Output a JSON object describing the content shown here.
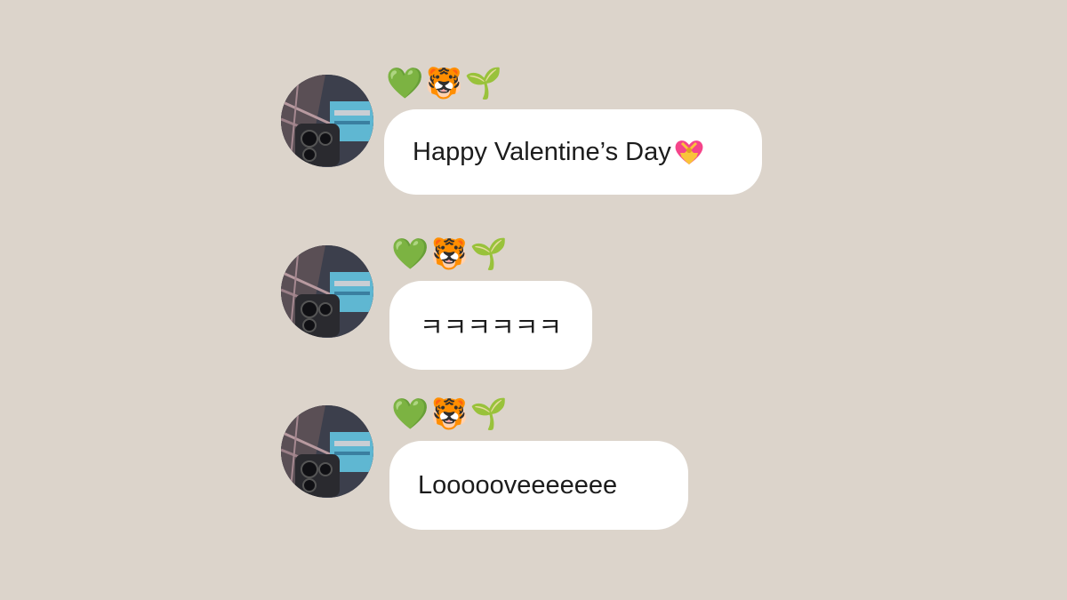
{
  "sender": {
    "display_name": {
      "heart": "💚",
      "tiger": "🐯",
      "sprout": "🌱"
    },
    "avatar_icon": "profile-photo-avatar"
  },
  "messages": [
    {
      "text": "Happy Valentine’s Day",
      "trailing_emoji": "💝"
    },
    {
      "text": "ㅋㅋㅋㅋㅋㅋ"
    },
    {
      "text": "Loooooveeeeeee"
    }
  ],
  "colors": {
    "background": "#dcd4cb",
    "bubble": "#ffffff",
    "text": "#1c1c1c"
  }
}
